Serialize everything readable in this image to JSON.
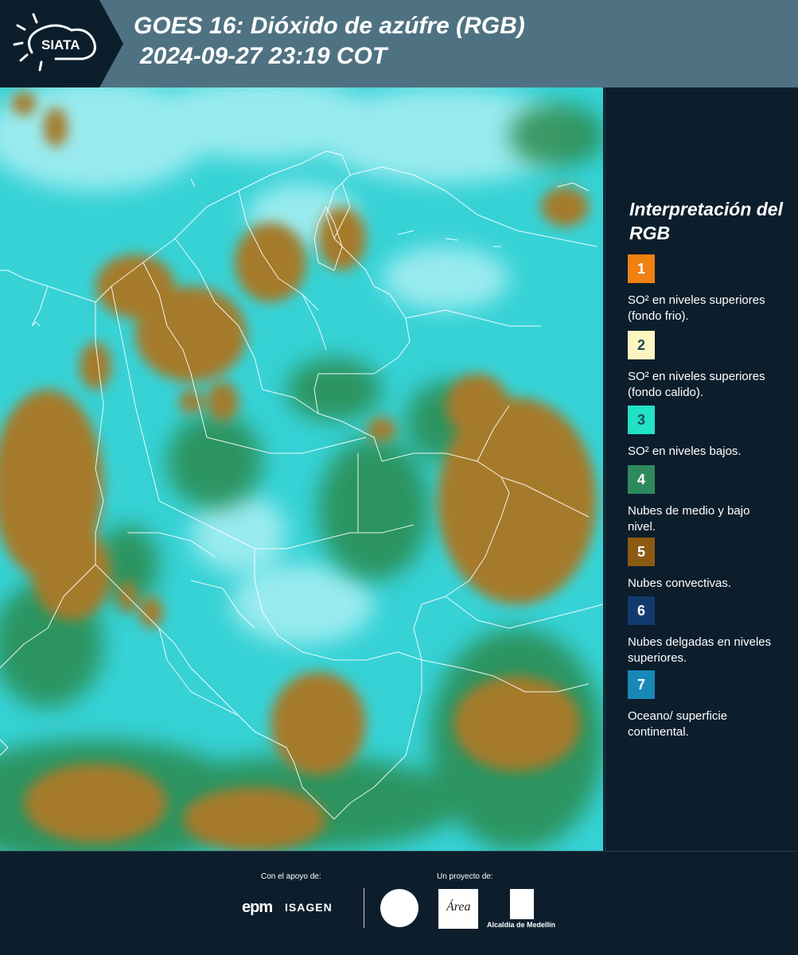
{
  "header": {
    "logo_text": "SIATA",
    "title_line1": "GOES 16: Dióxido de azúfre (RGB)",
    "title_line2": "2024-09-27 23:19 COT"
  },
  "legend": {
    "title": "Interpretación del RGB",
    "items": [
      {
        "number": "1",
        "color": "#f08010",
        "text": "SO² en niveles superiores (fondo frio)."
      },
      {
        "number": "2",
        "color": "#fdf5c0",
        "text": "SO² en niveles superiores (fondo calido)."
      },
      {
        "number": "3",
        "color": "#22e2c6",
        "text": "SO² en niveles bajos."
      },
      {
        "number": "4",
        "color": "#2e8a5e",
        "text": "Nubes de medio y bajo nivel."
      },
      {
        "number": "5",
        "color": "#8c5a12",
        "text": "Nubes convectivas."
      },
      {
        "number": "6",
        "color": "#123a6e",
        "text": "Nubes delgadas en niveles superiores."
      },
      {
        "number": "7",
        "color": "#1888b8",
        "text": "Oceano/ superficie continental."
      }
    ]
  },
  "footer": {
    "support_label": "Con el apoyo de:",
    "project_label": "Un proyecto de:",
    "epm_text": "epm",
    "isagen_text": "ISAGEN",
    "area_text": "Área",
    "alcaldia_text": "Alcaldía de Medellín"
  },
  "map_colors": {
    "sky": "#36d2d6",
    "pale": "#a4eef2",
    "green": "#2a8a4e",
    "convective": "#a57a2c",
    "border": "#ffffff"
  }
}
